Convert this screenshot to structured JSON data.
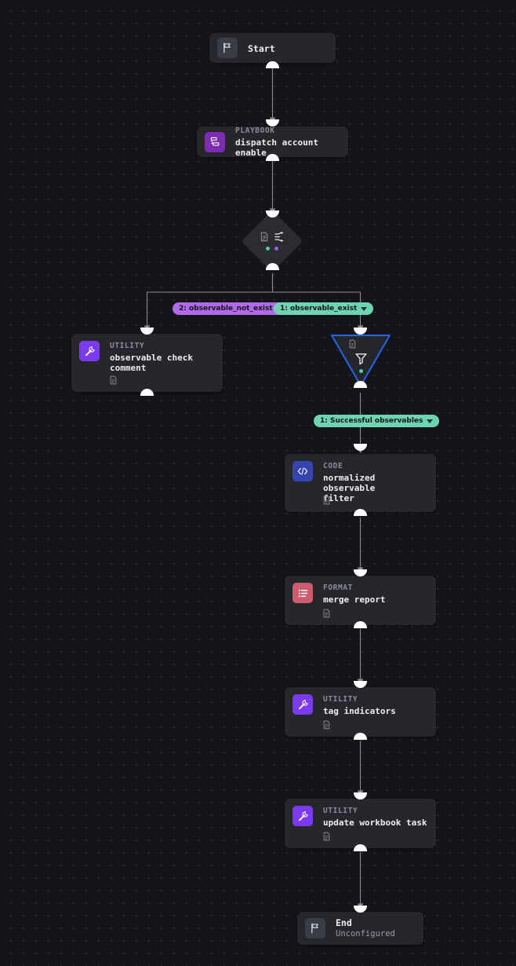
{
  "canvas": {
    "background_color": "#141518",
    "grid_dot_color": "#2e2f34",
    "node_bg_color": "#26272c",
    "edge_color": "#8a8c93",
    "port_color": "#fbfbfc"
  },
  "nodes": {
    "start": {
      "title": "Start",
      "subtitle": "",
      "icon": "flag-icon",
      "icon_bg": "#3a3c43"
    },
    "playbook": {
      "kind": "PLAYBOOK",
      "title": "dispatch account enable",
      "icon": "playbook-icon",
      "icon_bg": "#7c2cb0"
    },
    "branch": {
      "icon_document": "document-icon",
      "icon_branch": "branch-shuffle-icon",
      "dot_colors": [
        "#4ad0a4",
        "#9b5cf0"
      ]
    },
    "observable_check_comment": {
      "kind": "UTILITY",
      "title": "observable check\ncomment",
      "icon": "wrench-icon",
      "icon_bg": "#7c3aed"
    },
    "filter": {
      "icon_document": "document-icon",
      "icon_filter": "funnel-icon",
      "dot_color": "#4ad0a4",
      "border_color": "#2563eb"
    },
    "normalized_observable_filter": {
      "kind": "CODE",
      "title": "normalized observable\nfilter",
      "icon": "code-brackets-icon",
      "icon_bg": "#3644b0"
    },
    "merge_report": {
      "kind": "FORMAT",
      "title": "merge report",
      "icon": "list-format-icon",
      "icon_bg": "#cc5c6e"
    },
    "tag_indicators": {
      "kind": "UTILITY",
      "title": "tag indicators",
      "icon": "wrench-icon",
      "icon_bg": "#7c3aed"
    },
    "update_workbook_task": {
      "kind": "UTILITY",
      "title": "update workbook task",
      "icon": "wrench-icon",
      "icon_bg": "#7c3aed"
    },
    "end": {
      "title": "End",
      "subtitle": "Unconfigured",
      "icon": "flag-icon",
      "icon_bg": "#3a3c43"
    }
  },
  "edge_labels": {
    "observable_not_exist": {
      "label": "2: observable_not_exist",
      "color": "#b06ae8"
    },
    "observable_exist": {
      "label": "1: observable_exist",
      "color": "#6ed3b0"
    },
    "successful_observables": {
      "label": "1: Successful observables",
      "color": "#6ed3b0"
    }
  }
}
